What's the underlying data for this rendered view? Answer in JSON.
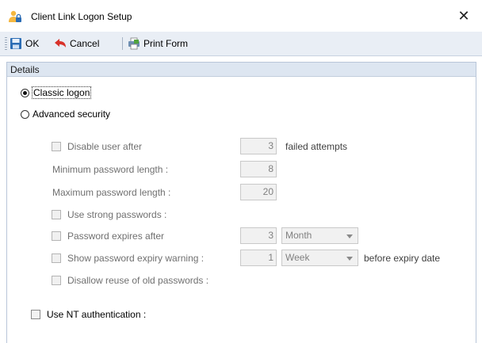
{
  "window": {
    "title": "Client Link Logon Setup"
  },
  "toolbar": {
    "ok_label": "OK",
    "cancel_label": "Cancel",
    "print_label": "Print Form"
  },
  "details": {
    "header": "Details",
    "classic_logon": "Classic logon",
    "advanced_security": "Advanced security",
    "disable_user_after": {
      "label": "Disable user after",
      "value": "3",
      "suffix": "failed attempts"
    },
    "min_password_length": {
      "label": "Minimum password length :",
      "value": "8"
    },
    "max_password_length": {
      "label": "Maximum password length :",
      "value": "20"
    },
    "use_strong_passwords": "Use strong passwords :",
    "password_expires_after": {
      "label": "Password expires after",
      "value": "3",
      "unit": "Month"
    },
    "show_expiry_warning": {
      "label": "Show password expiry warning :",
      "value": "1",
      "unit": "Week",
      "suffix": "before expiry date"
    },
    "disallow_reuse": "Disallow reuse of old passwords :",
    "use_nt_authentication": "Use NT authentication :"
  },
  "colors": {
    "toolbar_bg": "#e9eef5",
    "header_bg": "#dde6f1",
    "save_icon": "#2b6cb4",
    "cancel_icon": "#d8322a"
  }
}
